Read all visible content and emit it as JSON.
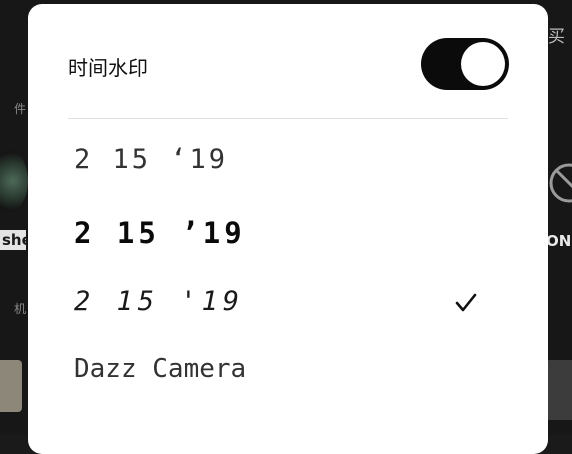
{
  "background": {
    "left_top_label": "件",
    "left_bottom_label": "机",
    "left_name_label": "she",
    "right_top_label": "买",
    "right_name_label": "ON"
  },
  "sheet": {
    "title": "时间水印",
    "toggle_on": true,
    "accent_color": "#0b0b0b",
    "options": [
      {
        "label": "2 15 ‘19",
        "selected": false
      },
      {
        "label": "2 15 ’19",
        "selected": false
      },
      {
        "label": "2 15 '19",
        "selected": true
      },
      {
        "label": "Dazz Camera",
        "selected": false
      }
    ]
  }
}
